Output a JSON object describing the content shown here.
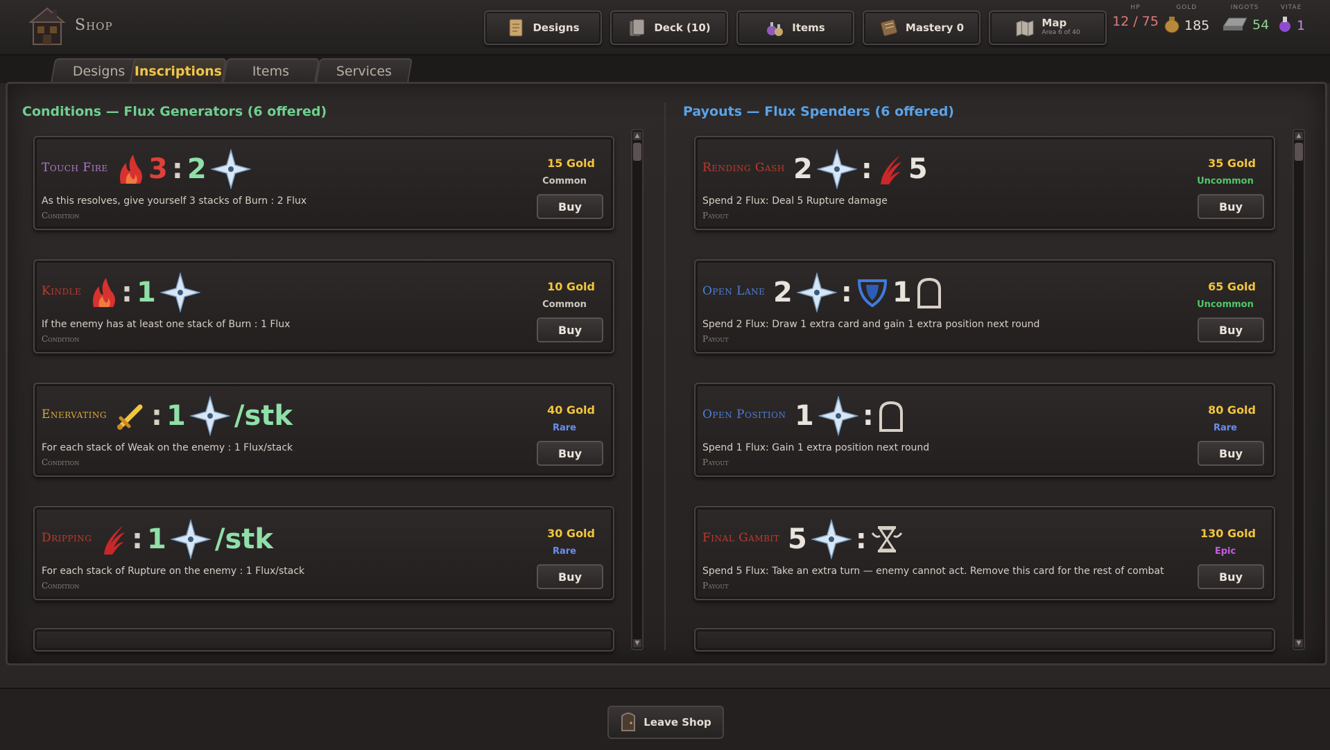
{
  "header": {
    "title": "Shop",
    "nav": [
      {
        "label": "Designs",
        "icon": "scroll-icon"
      },
      {
        "label": "Deck (10)",
        "icon": "deck-icon"
      },
      {
        "label": "Items",
        "icon": "potions-icon"
      },
      {
        "label": "Mastery 0",
        "icon": "book-icon"
      },
      {
        "label": "Map",
        "sub": "Area 6 of 40",
        "icon": "map-icon"
      }
    ],
    "stats": {
      "hp": {
        "label": "HP",
        "value": "12 / 75",
        "color": "#e07a7a"
      },
      "gold": {
        "label": "GOLD",
        "value": "185",
        "color": "#e8e0d6"
      },
      "ingots": {
        "label": "INGOTS",
        "value": "54",
        "color": "#8fd38f"
      },
      "vitae": {
        "label": "VITAE",
        "value": "1",
        "color": "#c78be0"
      }
    }
  },
  "tabs": [
    "Designs",
    "Inscriptions",
    "Items",
    "Services"
  ],
  "active_tab": "Inscriptions",
  "left": {
    "heading": "Conditions — Flux Generators  (6 offered)",
    "heading_color": "#6fd08f",
    "cards": [
      {
        "name": "Touch Fire",
        "name_color": "#b07ac8",
        "formula": [
          "fire-icon",
          "3",
          ":",
          "2",
          "flux-icon"
        ],
        "desc": "As this resolves, give yourself 3 stacks of Burn : 2 Flux",
        "type": "Condition",
        "price": "15 Gold",
        "rarity": "Common",
        "rarity_color": "#cfc8c0",
        "buy": "Buy"
      },
      {
        "name": "Kindle",
        "name_color": "#c0392b",
        "formula": [
          "fire-icon",
          ":",
          "1",
          "flux-icon"
        ],
        "desc": "If the enemy has at least one stack of Burn : 1 Flux",
        "type": "Condition",
        "price": "10 Gold",
        "rarity": "Common",
        "rarity_color": "#cfc8c0",
        "buy": "Buy"
      },
      {
        "name": "Enervating",
        "name_color": "#d7a83a",
        "formula": [
          "sword-icon",
          ":",
          "1",
          "flux-icon",
          "/stk"
        ],
        "desc": "For each stack of Weak on the enemy : 1 Flux/stack",
        "type": "Condition",
        "price": "40 Gold",
        "rarity": "Rare",
        "rarity_color": "#6a8ef0",
        "buy": "Buy"
      },
      {
        "name": "Dripping",
        "name_color": "#c0392b",
        "formula": [
          "claw-icon",
          ":",
          "1",
          "flux-icon",
          "/stk"
        ],
        "desc": "For each stack of Rupture on the enemy : 1 Flux/stack",
        "type": "Condition",
        "price": "30 Gold",
        "rarity": "Rare",
        "rarity_color": "#6a8ef0",
        "buy": "Buy"
      }
    ]
  },
  "right": {
    "heading": "Payouts — Flux Spenders  (6 offered)",
    "heading_color": "#5aa3e8",
    "cards": [
      {
        "name": "Rending Gash",
        "name_color": "#c0392b",
        "formula": [
          "2",
          "flux-icon",
          ":",
          "claw-icon",
          "5"
        ],
        "desc": "Spend 2 Flux: Deal 5 Rupture damage",
        "type": "Payout",
        "price": "35 Gold",
        "rarity": "Uncommon",
        "rarity_color": "#4fc86a",
        "buy": "Buy"
      },
      {
        "name": "Open Lane",
        "name_color": "#4a7fd6",
        "formula": [
          "2",
          "flux-icon",
          ":",
          "shield-icon",
          "1",
          "position-icon"
        ],
        "desc": "Spend 2 Flux: Draw 1 extra card and gain 1 extra position next round",
        "type": "Payout",
        "price": "65 Gold",
        "rarity": "Uncommon",
        "rarity_color": "#4fc86a",
        "buy": "Buy"
      },
      {
        "name": "Open Position",
        "name_color": "#4a7fd6",
        "formula": [
          "1",
          "flux-icon",
          ":",
          "position-icon"
        ],
        "desc": "Spend 1 Flux: Gain 1 extra position next round",
        "type": "Payout",
        "price": "80 Gold",
        "rarity": "Rare",
        "rarity_color": "#6a8ef0",
        "buy": "Buy"
      },
      {
        "name": "Final Gambit",
        "name_color": "#c0392b",
        "formula": [
          "5",
          "flux-icon",
          ":",
          "hourglass-icon"
        ],
        "desc": "Spend 5 Flux: Take an extra turn — enemy cannot act. Remove this card for the rest of combat",
        "type": "Payout",
        "price": "130 Gold",
        "rarity": "Epic",
        "rarity_color": "#c45ee0",
        "buy": "Buy"
      }
    ]
  },
  "footer": {
    "leave_label": "Leave Shop"
  }
}
